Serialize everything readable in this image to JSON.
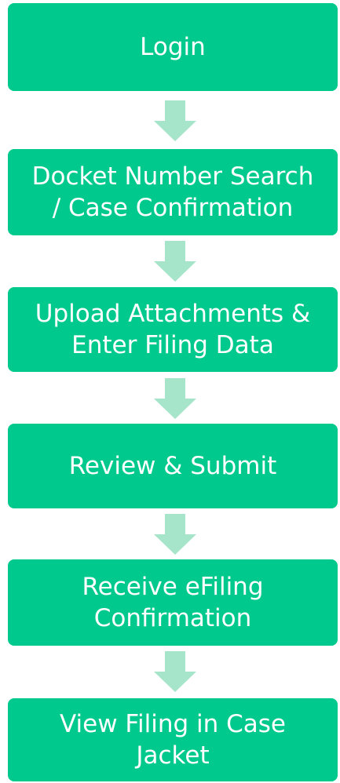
{
  "flow": {
    "steps": [
      {
        "label": "Login"
      },
      {
        "label": "Docket Number Search\n/ Case Confirmation"
      },
      {
        "label": "Upload Attachments &\nEnter Filing Data"
      },
      {
        "label": "Review & Submit"
      },
      {
        "label": "Receive eFiling\nConfirmation"
      },
      {
        "label": "View Filing in Case\nJacket"
      }
    ]
  },
  "colors": {
    "step_fill": "#00c98d",
    "step_text": "#ffffff",
    "arrow_fill": "#a6e5c9"
  }
}
